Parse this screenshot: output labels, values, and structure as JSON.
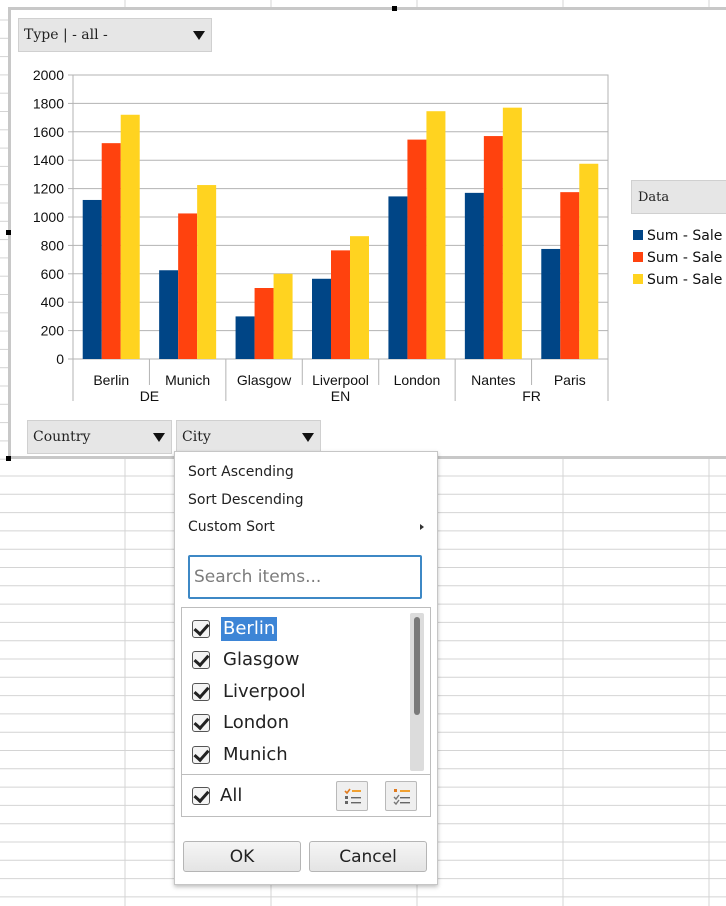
{
  "chart_data": {
    "type": "bar",
    "title": "",
    "xlabel": "",
    "ylabel": "",
    "ylim": [
      0,
      2000
    ],
    "yticks": [
      0,
      200,
      400,
      600,
      800,
      1000,
      1200,
      1400,
      1600,
      1800,
      2000
    ],
    "grid": true,
    "legend_position": "right",
    "categories": [
      "Berlin",
      "Munich",
      "Glasgow",
      "Liverpool",
      "London",
      "Nantes",
      "Paris"
    ],
    "groups": [
      {
        "label": "DE",
        "count": 2
      },
      {
        "label": "EN",
        "count": 3
      },
      {
        "label": "FR",
        "count": 2
      }
    ],
    "series": [
      {
        "name": "Sum - Sale",
        "color": "#004586",
        "values": [
          1120,
          625,
          300,
          565,
          1145,
          1170,
          775
        ]
      },
      {
        "name": "Sum - Sale",
        "color": "#ff420e",
        "values": [
          1520,
          1025,
          500,
          765,
          1545,
          1570,
          1175
        ]
      },
      {
        "name": "Sum - Sale",
        "color": "#ffd320",
        "values": [
          1720,
          1225,
          600,
          865,
          1745,
          1770,
          1375
        ]
      }
    ]
  },
  "fields": {
    "type_filter": "Type | - all -",
    "country": "Country",
    "city": "City",
    "data": "Data"
  },
  "popup": {
    "sort_ascending": "Sort Ascending",
    "sort_descending": "Sort Descending",
    "custom_sort": "Custom Sort",
    "search_placeholder": "Search items...",
    "items": [
      "Berlin",
      "Glasgow",
      "Liverpool",
      "London",
      "Munich"
    ],
    "all_label": "All",
    "ok": "OK",
    "cancel": "Cancel"
  },
  "colors": {
    "selection": "#3d85d6",
    "search_border": "#3d88c5"
  }
}
